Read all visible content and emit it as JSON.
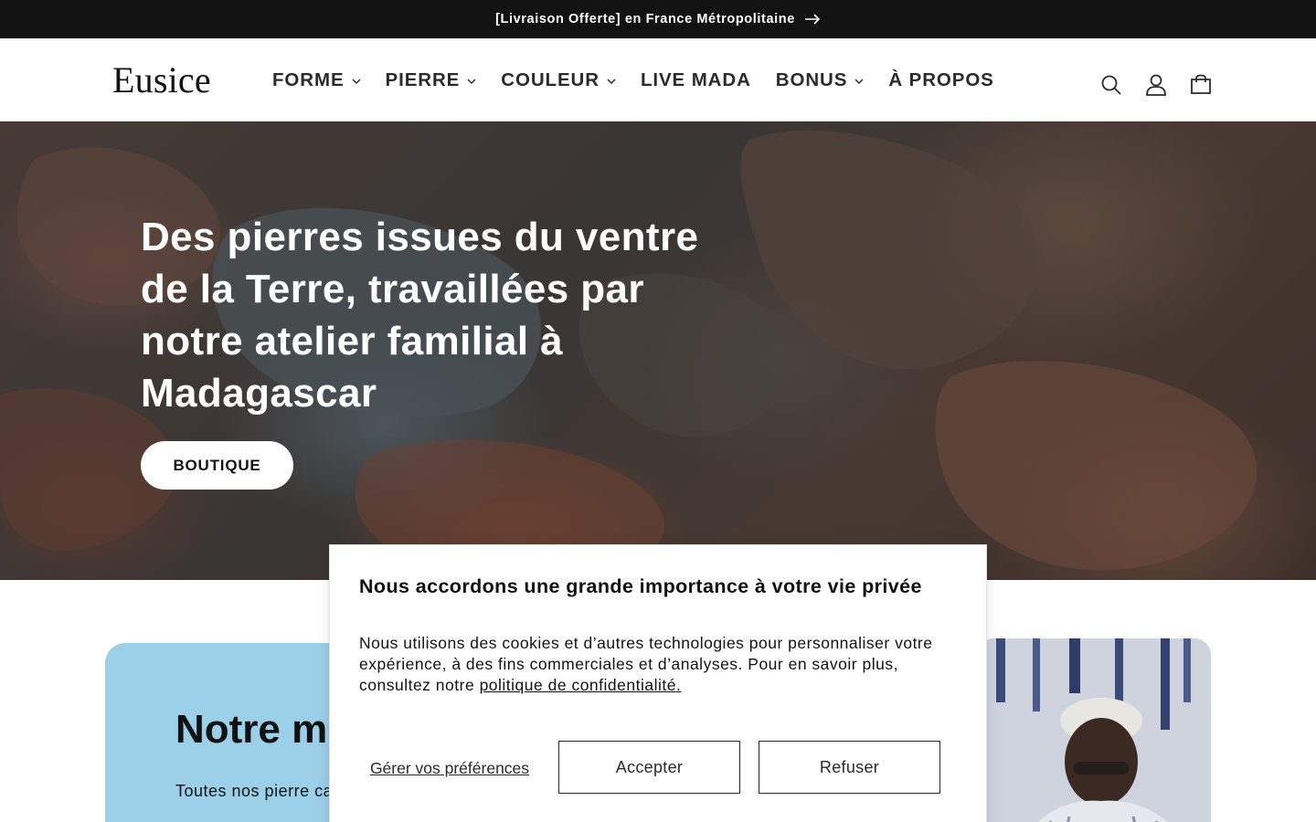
{
  "announcement": {
    "text": "[Livraison Offerte] en France Métropolitaine"
  },
  "header": {
    "logo": "Eusice",
    "nav": [
      {
        "label": "FORME",
        "has_dropdown": true
      },
      {
        "label": "PIERRE",
        "has_dropdown": true
      },
      {
        "label": "COULEUR",
        "has_dropdown": true
      },
      {
        "label": "LIVE MADA",
        "has_dropdown": false
      },
      {
        "label": "BONUS",
        "has_dropdown": true
      },
      {
        "label": "À PROPOS",
        "has_dropdown": false
      }
    ],
    "icons": [
      "search-icon",
      "account-icon",
      "cart-icon"
    ]
  },
  "hero": {
    "heading": "Des pierres issues du ventre de la Terre, travaillées par notre atelier familial à Madagascar",
    "button_label": "BOUTIQUE"
  },
  "mission": {
    "title_visible": "Notre m",
    "text_visible": "Toutes nos pierre capitale de Mada"
  },
  "cookie": {
    "title": "Nous accordons une grande importance à votre vie privée",
    "body": "Nous utilisons des cookies et d’autres technologies pour personnaliser votre expérience, à des fins commerciales et d’analyses. Pour en savoir plus, consultez notre",
    "link_text": "politique de confidentialité.",
    "manage_label": "Gérer vos préférences",
    "accept_label": "Accepter",
    "refuse_label": "Refuser"
  },
  "colors": {
    "announcement_bg": "#121212",
    "mission_card_bg": "#9ccfe8",
    "text": "#121212"
  }
}
